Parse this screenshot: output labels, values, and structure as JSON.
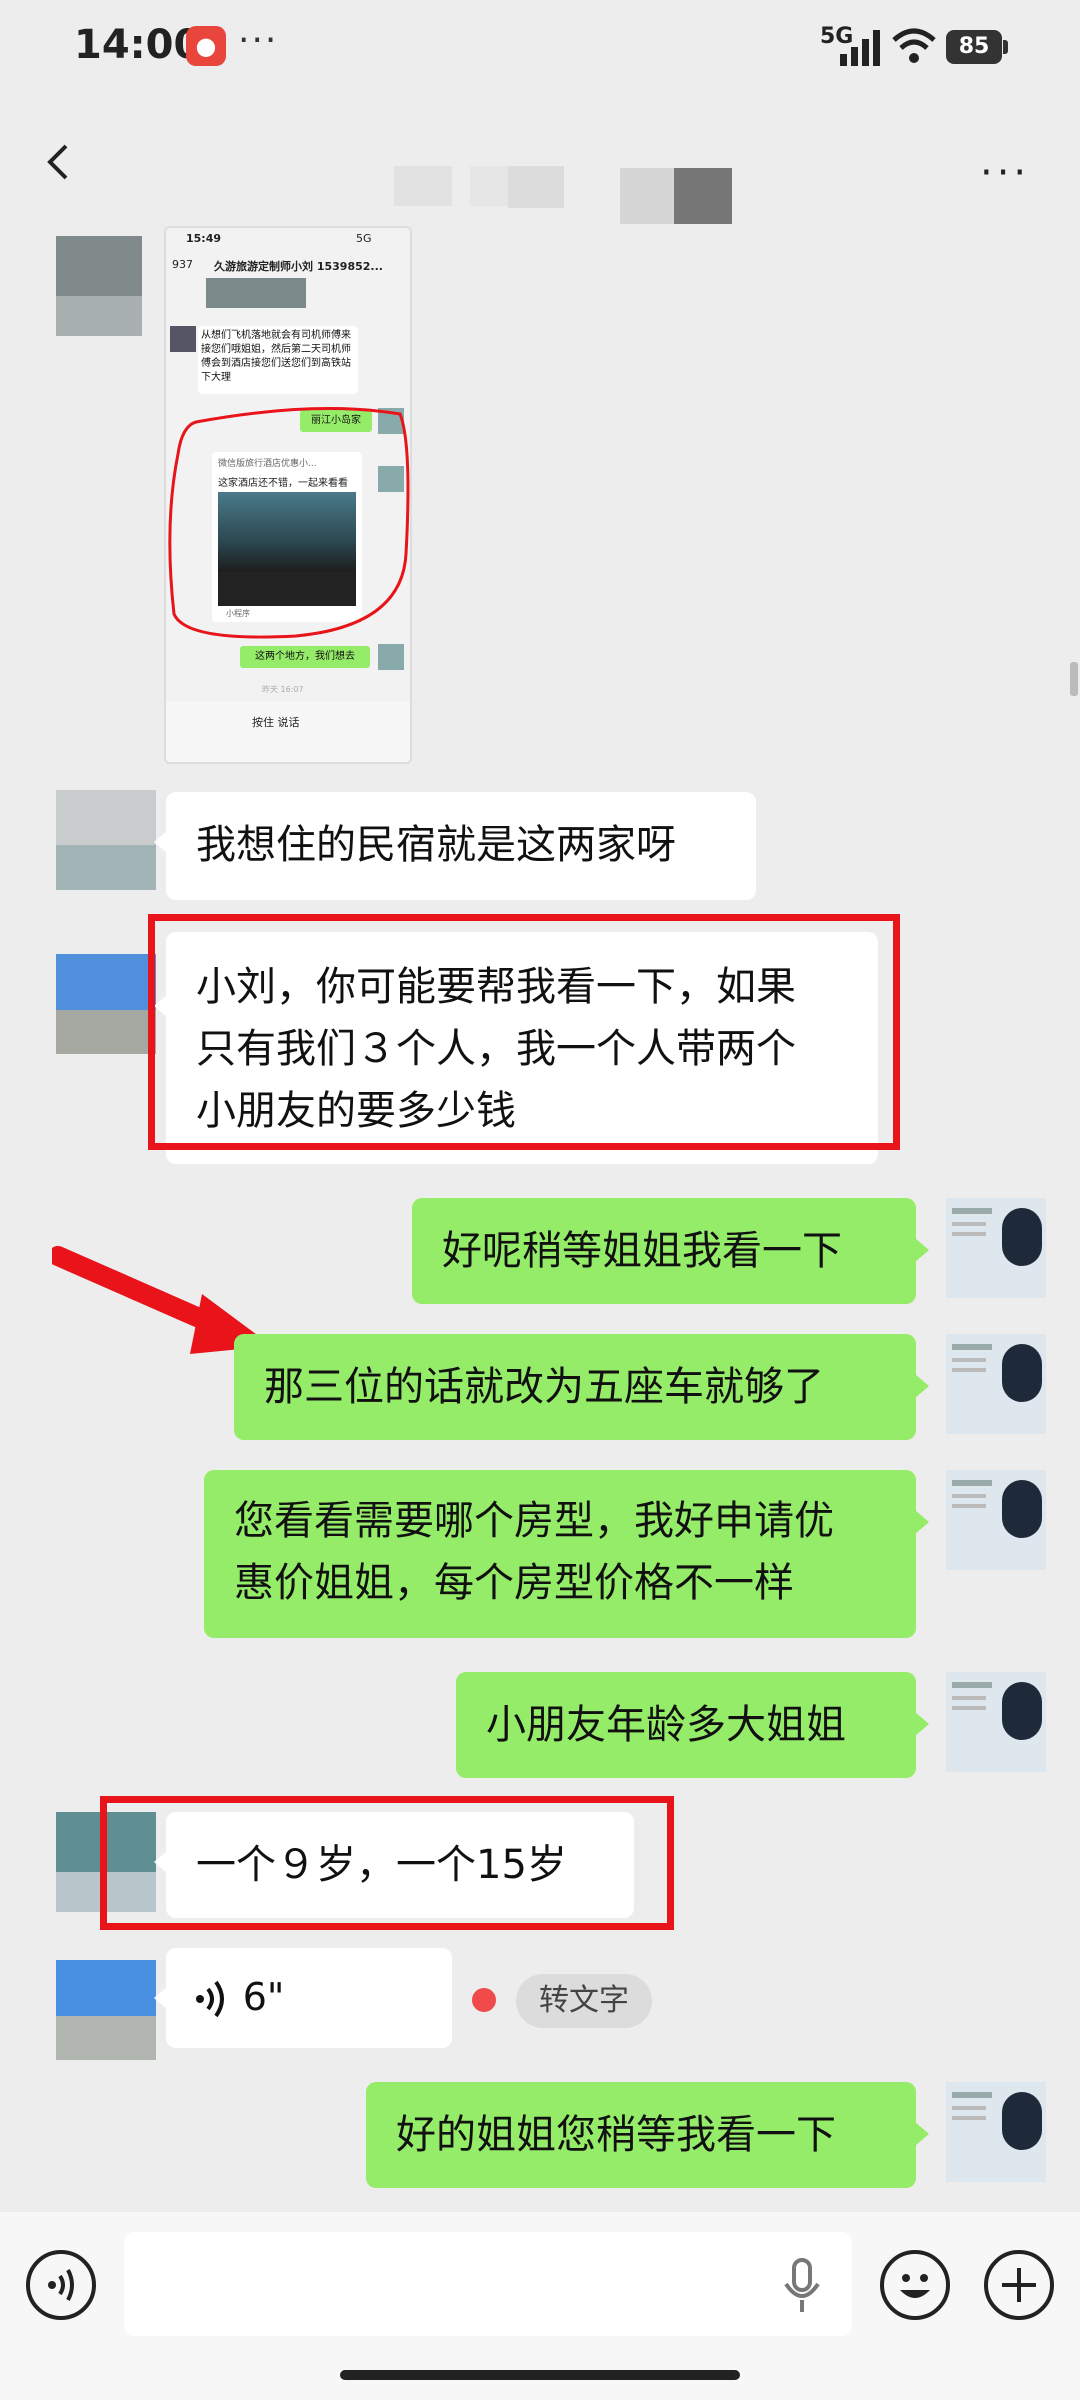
{
  "status_bar": {
    "time": "14:00",
    "network": "5G",
    "battery": "85"
  },
  "header": {
    "more_label": "···"
  },
  "thumbnail": {
    "time": "15:49",
    "network": "5G",
    "chat_title": "久游旅游定制师小刘 1539852...",
    "unread": "937",
    "msg_in": "从想们飞机落地就会有司机师傅来接您们哦姐姐，然后第二天司机师傅会到酒店接您们送您们到高铁站下大理",
    "msg_out_1": "丽江小岛家",
    "card_head": "微信版旅行酒店优惠小...",
    "card_text": "这家酒店还不错，一起来看看",
    "card_footer": "小程序",
    "msg_out_2": "这两个地方，我们想去",
    "hold_to_talk": "按住 说话",
    "timestamp": "昨天 16:07"
  },
  "messages": [
    {
      "side": "in",
      "text": "我想住的民宿就是这两家呀"
    },
    {
      "side": "in",
      "lines": [
        "小刘，你可能要帮我看一下，如果",
        "只有我们３个人，我一个人带两个",
        "小朋友的要多少钱"
      ]
    },
    {
      "side": "out",
      "text": "好呢稍等姐姐我看一下"
    },
    {
      "side": "out",
      "text": "那三位的话就改为五座车就够了"
    },
    {
      "side": "out",
      "lines": [
        "您看看需要哪个房型，我好申请优",
        "惠价姐姐，每个房型价格不一样"
      ]
    },
    {
      "side": "out",
      "text": "小朋友年龄多大姐姐"
    },
    {
      "side": "in",
      "text": "一个９岁，一个15岁"
    },
    {
      "side": "in",
      "voice_duration": "6\"",
      "convert_label": "转文字"
    },
    {
      "side": "out",
      "text": "好的姐姐您稍等我看一下"
    }
  ],
  "colors": {
    "background": "#ededed",
    "outgoing_bubble": "#95ec69",
    "incoming_bubble": "#ffffff",
    "annotation_red": "#e8141a"
  },
  "icons": [
    "back-icon",
    "more-icon",
    "voice-mode-icon",
    "microphone-icon",
    "emoji-icon",
    "plus-icon",
    "arrow-annotation"
  ]
}
